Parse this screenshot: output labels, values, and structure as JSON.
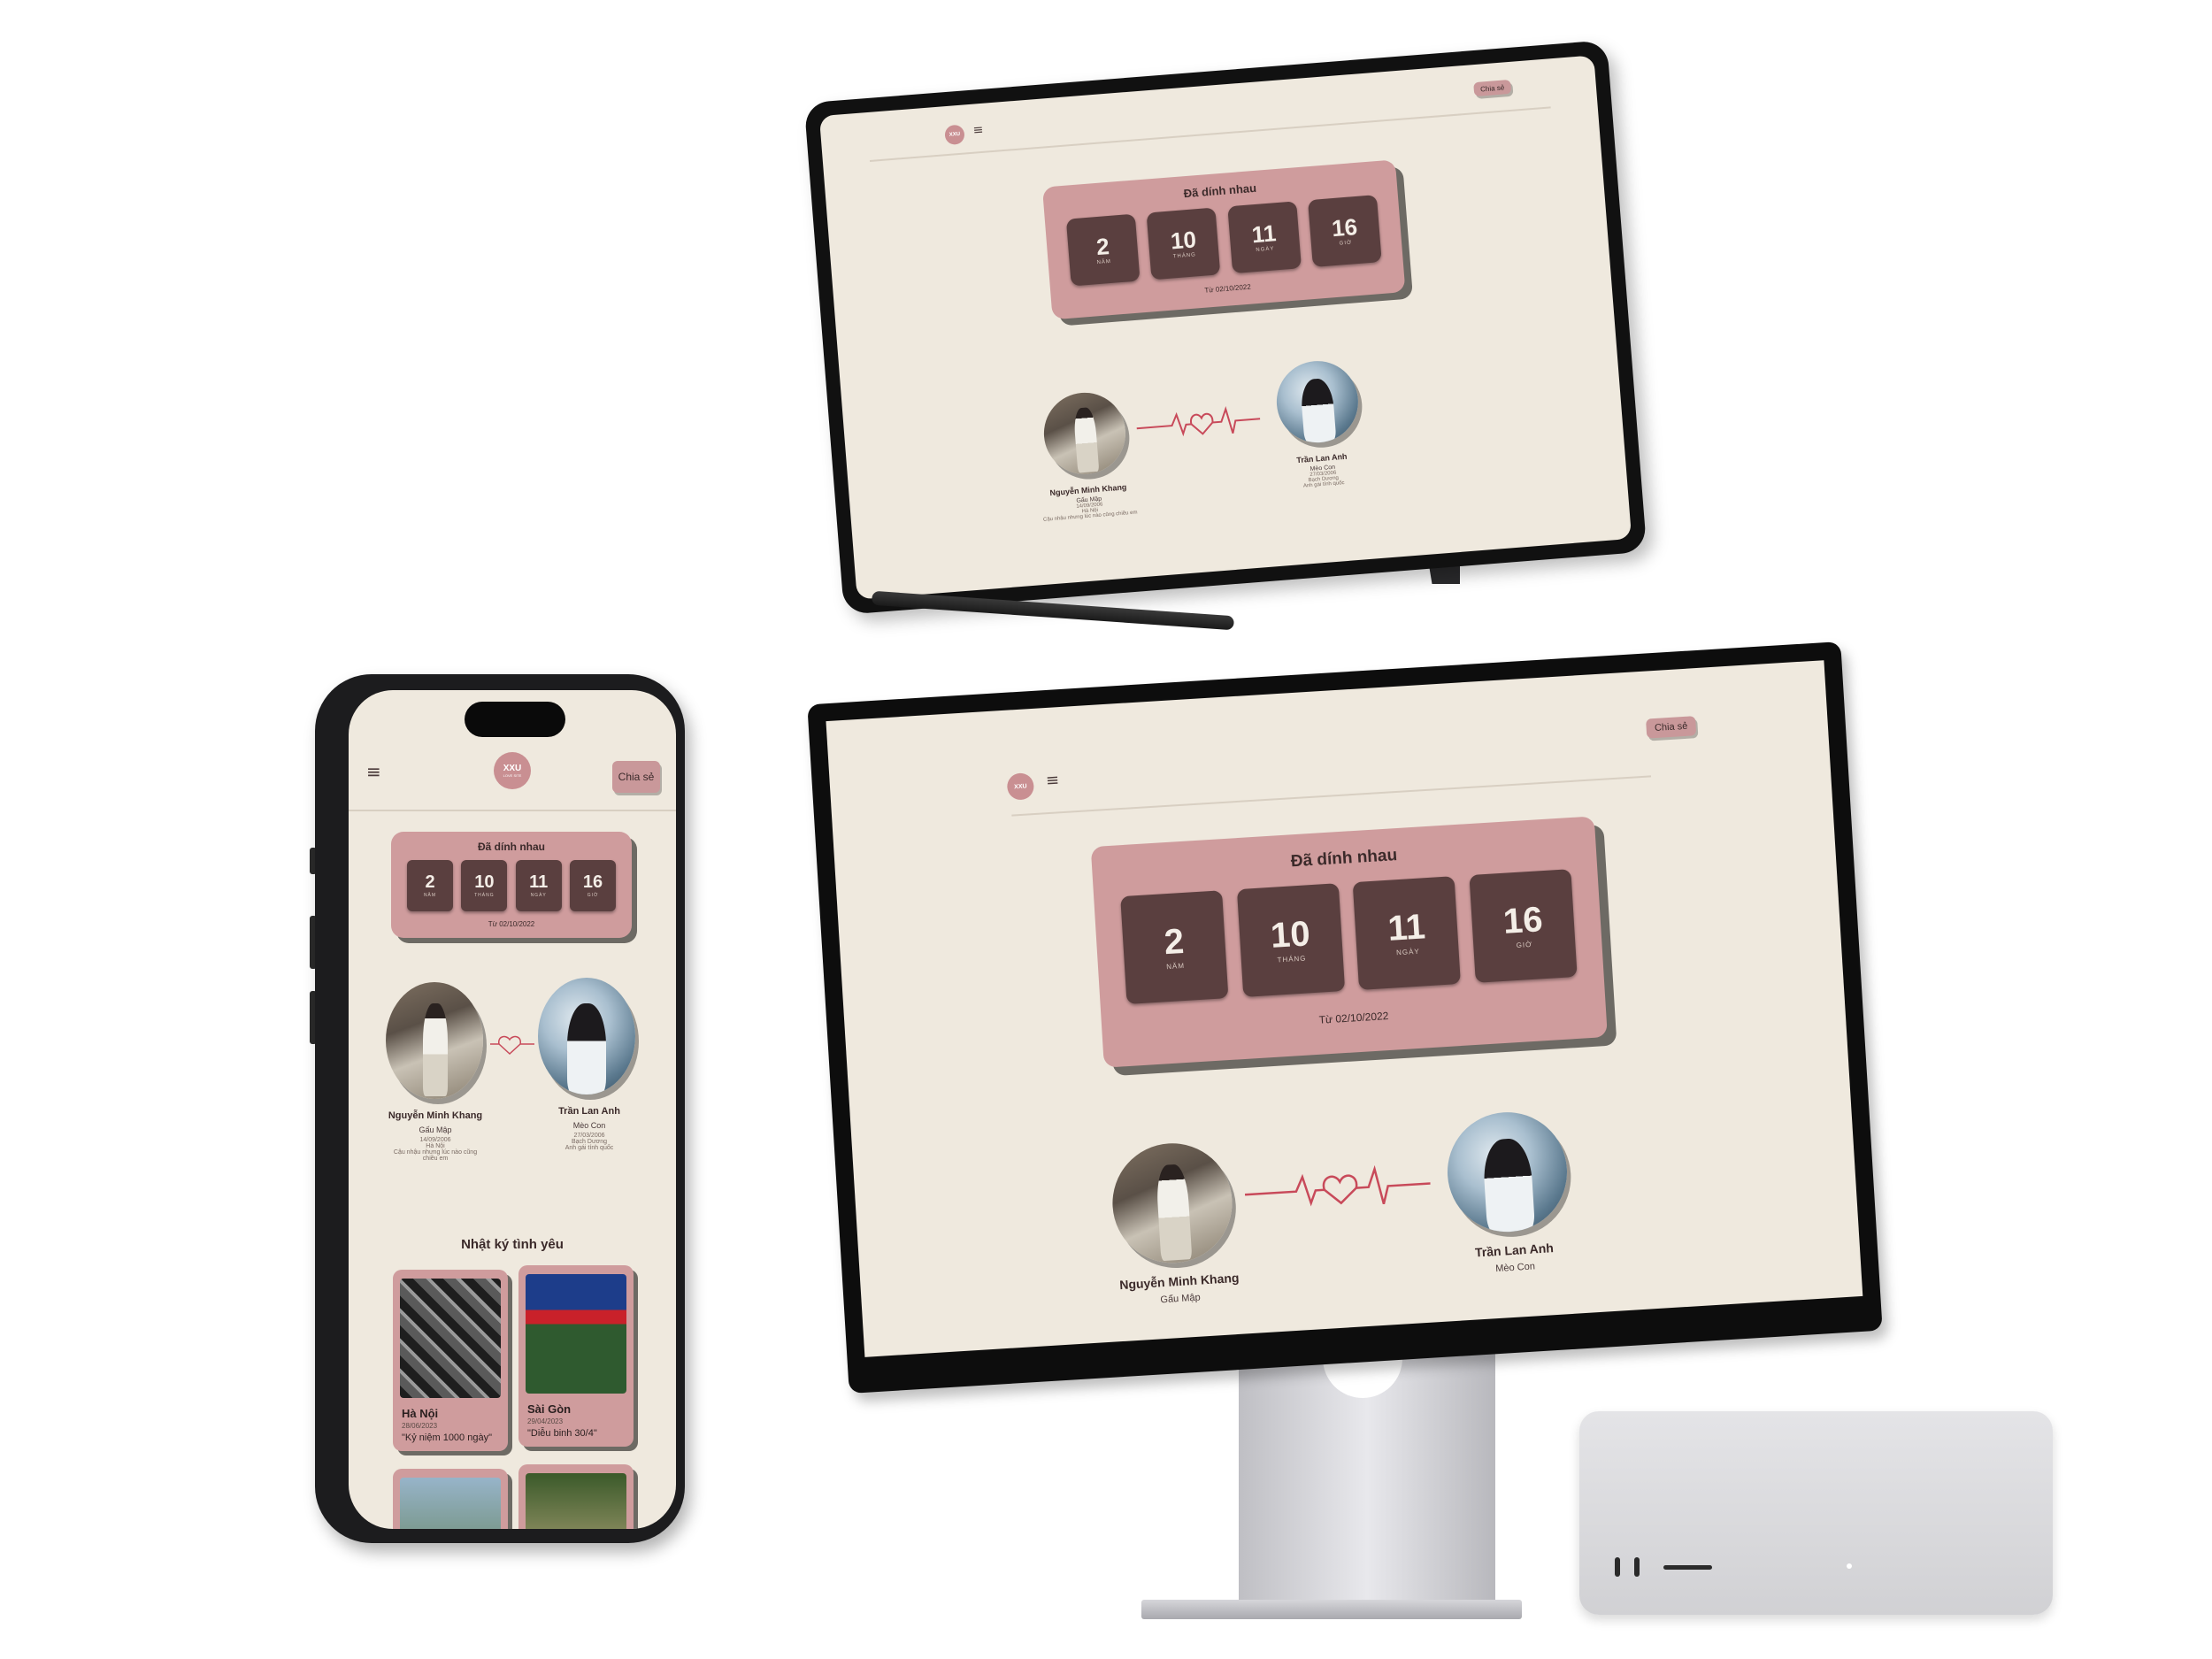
{
  "share_label": "Chia sẻ",
  "logo": {
    "initials": "XXU",
    "sub": "LOVE SITE"
  },
  "menu_icon": "≡",
  "icons": {
    "menu": "hamburger-icon",
    "heartbeat": "heart-pulse-icon"
  },
  "colors": {
    "background": "#efe9de",
    "card": "#cf9c9d",
    "unit": "#5a3f3f",
    "accent": "#c84a5a"
  },
  "counter": {
    "title": "Đã dính nhau",
    "since": "Từ 02/10/2022",
    "units": [
      {
        "value": "2",
        "label": "NĂM"
      },
      {
        "value": "10",
        "label": "THÁNG"
      },
      {
        "value": "11",
        "label": "NGÀY"
      },
      {
        "value": "16",
        "label": "GIỜ"
      }
    ]
  },
  "couple": {
    "him": {
      "name": "Nguyễn Minh Khang",
      "nick": "Gấu Mập",
      "birthday": "14/09/2006",
      "place": "Hà Nội",
      "quote": "Cậu nhậu nhưng lúc nào cũng chiều em"
    },
    "her": {
      "name": "Trần Lan Anh",
      "nick": "Mèo Con",
      "birthday": "27/03/2006",
      "place": "Bạch Dương",
      "quote": "Anh gái tính quốc"
    }
  },
  "diary": {
    "title": "Nhật ký tình yêu",
    "entries": [
      {
        "city": "Hà Nội",
        "date": "28/06/2023",
        "quote": "\"Kỷ niệm 1000 ngày\""
      },
      {
        "city": "Sài Gòn",
        "date": "29/04/2023",
        "quote": "\"Diễu binh 30/4\""
      }
    ]
  }
}
